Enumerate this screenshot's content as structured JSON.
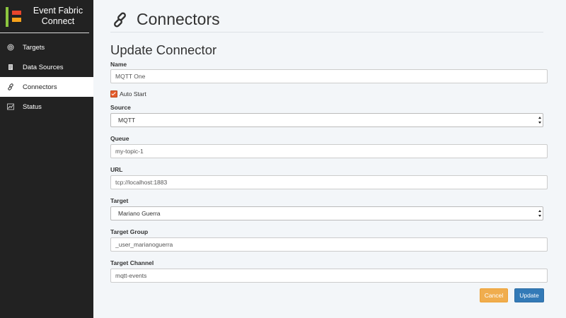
{
  "brand": {
    "line1": "Event Fabric",
    "line2": "Connect"
  },
  "sidebar": {
    "items": [
      {
        "label": "Targets",
        "icon": "target-icon",
        "active": false
      },
      {
        "label": "Data Sources",
        "icon": "document-icon",
        "active": false
      },
      {
        "label": "Connectors",
        "icon": "link-icon",
        "active": true
      },
      {
        "label": "Status",
        "icon": "chart-icon",
        "active": false
      }
    ]
  },
  "header": {
    "title": "Connectors",
    "icon": "link-icon"
  },
  "form": {
    "title": "Update Connector",
    "name": {
      "label": "Name",
      "value": "MQTT One"
    },
    "auto_start": {
      "label": "Auto Start",
      "checked": true
    },
    "source": {
      "label": "Source",
      "value": "MQTT"
    },
    "queue": {
      "label": "Queue",
      "value": "my-topic-1"
    },
    "url": {
      "label": "URL",
      "value": "tcp://localhost:1883"
    },
    "target": {
      "label": "Target",
      "value": "Mariano Guerra"
    },
    "target_group": {
      "label": "Target Group",
      "value": "_user_marianoguerra"
    },
    "target_channel": {
      "label": "Target Channel",
      "value": "mqtt-events"
    },
    "cancel_label": "Cancel",
    "update_label": "Update"
  },
  "colors": {
    "sidebar_bg": "#222222",
    "page_bg": "#f3f6f9",
    "cancel": "#f0ad4e",
    "update": "#337ab7",
    "checkbox": "#e55c2b"
  }
}
